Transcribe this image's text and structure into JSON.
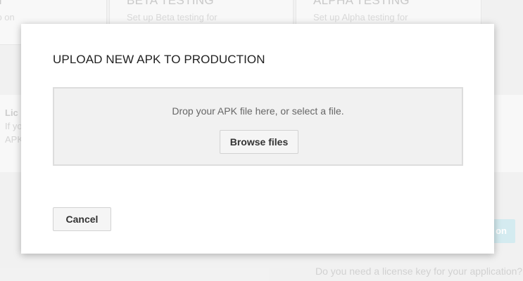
{
  "background": {
    "cards": [
      {
        "title": "ON",
        "description": "app on"
      },
      {
        "title": "BETA TESTING",
        "description": "Set up Beta testing for"
      },
      {
        "title": "ALPHA TESTING",
        "description": "Set up Alpha testing for"
      }
    ],
    "license": {
      "title": "Lic",
      "line1": "If yo",
      "line2": "APK"
    },
    "action_button_label": "on",
    "footer_question": "Do you need a license key for your application?"
  },
  "dialog": {
    "title": "UPLOAD NEW APK TO PRODUCTION",
    "dropzone": {
      "hint": "Drop your APK file here, or select a file.",
      "browse_label": "Browse files"
    },
    "cancel_label": "Cancel"
  }
}
